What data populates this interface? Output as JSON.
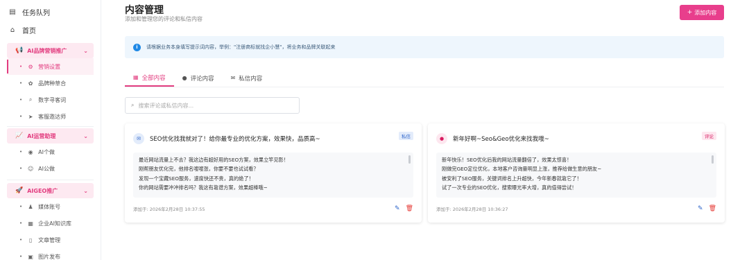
{
  "sidebar": {
    "top": [
      {
        "label": "任务队列",
        "icon": "list-icon"
      },
      {
        "label": "首页",
        "icon": "home-icon"
      }
    ],
    "groups": [
      {
        "label": "AI品牌营销推广",
        "icon": "megaphone-icon",
        "items": [
          {
            "label": "营销设置",
            "icon": "gear-icon",
            "active": true
          },
          {
            "label": "品牌种草合",
            "icon": "seedling-icon"
          },
          {
            "label": "数字寻客词",
            "icon": "search-icon"
          },
          {
            "label": "客服邀达师",
            "icon": "send-icon"
          }
        ]
      },
      {
        "label": "AI运营助理",
        "icon": "chart-icon",
        "items": [
          {
            "label": "AI个做",
            "icon": "user-circle-icon"
          },
          {
            "label": "AI公做",
            "icon": "users-icon"
          }
        ]
      },
      {
        "label": "AIGEO推广",
        "icon": "rocket-icon",
        "items": [
          {
            "label": "媒体账号",
            "icon": "person-icon"
          },
          {
            "label": "企业AI知识库",
            "icon": "database-icon"
          },
          {
            "label": "文章管理",
            "icon": "document-icon"
          },
          {
            "label": "图片发布",
            "icon": "image-icon"
          }
        ]
      }
    ]
  },
  "header": {
    "title": "内容管理",
    "subtitle": "添加和管理您的评论和私信内容",
    "add_button": "添加内容"
  },
  "info": {
    "text": "请根据业务本身填写提示词内容，举例：\"注册商标就找企小慧\"，将业务和品牌关联起来"
  },
  "tabs": [
    {
      "label": "全部内容",
      "icon": "grid-icon",
      "active": true
    },
    {
      "label": "评论内容",
      "icon": "comment-icon"
    },
    {
      "label": "私信内容",
      "icon": "mail-icon"
    }
  ],
  "search": {
    "placeholder": "搜索评论或私信内容..."
  },
  "cards": [
    {
      "title": "SEO优化找我就对了！给你最专业的优化方案，效果快，品质高~",
      "badge": "私信",
      "type": "dm",
      "lines": [
        "最近网站流量上不去？我这边有超好用的SEO方案，效果立竿见影！",
        "刚帮朋友优化完，他排名嗖嗖涨，你要不要也试试看？",
        "发现一个宝藏SEO服务，速度快还不贵，真的绝了！",
        "你的网站需要冲冲排名吗？我这有靠谱方案，效果超棒哦~"
      ],
      "time": "添加于: 2026年2月28日 10:37:55"
    },
    {
      "title": "新年好啊~Seo&Geo优化来找我哦~",
      "badge": "评论",
      "type": "comment",
      "lines": [
        "新年快乐！SEO优化后我的网站流量翻倍了，效果太惊喜！",
        "刚做完GEO定位优化，本地客户咨询量明显上涨，推荐给做生意的朋友~",
        "被安利了SEO服务，关键词排名上升超快，今年新春就靠它了！",
        "试了一次专业的SEO优化，搜索曝光率大增，真的值得尝试！"
      ],
      "time": "添加于: 2026年2月28日 10:36:27"
    }
  ],
  "colors": {
    "accent": "#e83e8c",
    "info_bg": "#eef6fd",
    "info_icon": "#1e88e5"
  }
}
